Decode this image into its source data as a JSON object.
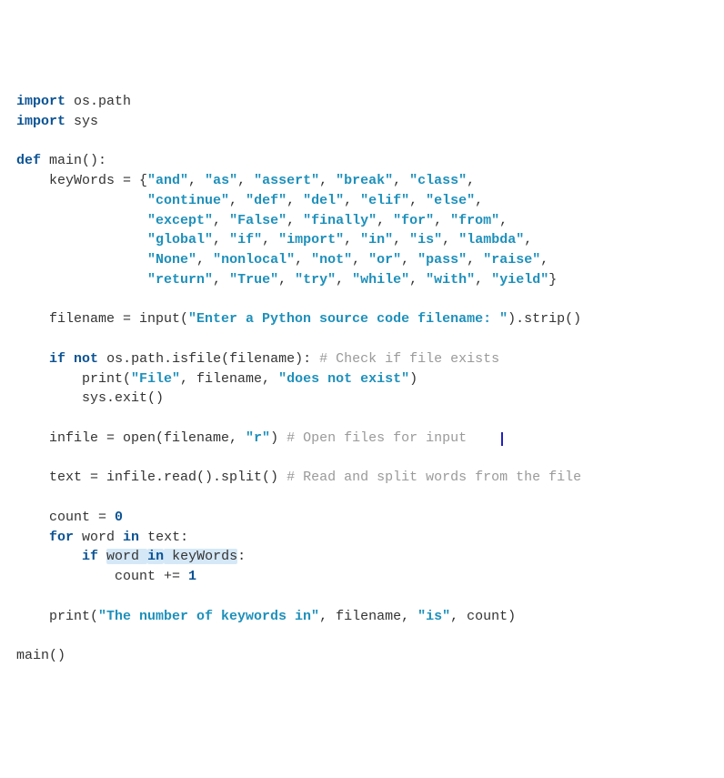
{
  "tokens": [
    {
      "t": "import",
      "c": "kw"
    },
    {
      "t": " os.path\n"
    },
    {
      "t": "import",
      "c": "kw"
    },
    {
      "t": " sys\n\n"
    },
    {
      "t": "def",
      "c": "kw"
    },
    {
      "t": " main():\n"
    },
    {
      "t": "    keyWords = {"
    },
    {
      "t": "\"and\"",
      "c": "str"
    },
    {
      "t": ", "
    },
    {
      "t": "\"as\"",
      "c": "str"
    },
    {
      "t": ", "
    },
    {
      "t": "\"assert\"",
      "c": "str"
    },
    {
      "t": ", "
    },
    {
      "t": "\"break\"",
      "c": "str"
    },
    {
      "t": ", "
    },
    {
      "t": "\"class\"",
      "c": "str"
    },
    {
      "t": ",\n"
    },
    {
      "t": "                "
    },
    {
      "t": "\"continue\"",
      "c": "str"
    },
    {
      "t": ", "
    },
    {
      "t": "\"def\"",
      "c": "str"
    },
    {
      "t": ", "
    },
    {
      "t": "\"del\"",
      "c": "str"
    },
    {
      "t": ", "
    },
    {
      "t": "\"elif\"",
      "c": "str"
    },
    {
      "t": ", "
    },
    {
      "t": "\"else\"",
      "c": "str"
    },
    {
      "t": ",\n"
    },
    {
      "t": "                "
    },
    {
      "t": "\"except\"",
      "c": "str"
    },
    {
      "t": ", "
    },
    {
      "t": "\"False\"",
      "c": "str"
    },
    {
      "t": ", "
    },
    {
      "t": "\"finally\"",
      "c": "str"
    },
    {
      "t": ", "
    },
    {
      "t": "\"for\"",
      "c": "str"
    },
    {
      "t": ", "
    },
    {
      "t": "\"from\"",
      "c": "str"
    },
    {
      "t": ",\n"
    },
    {
      "t": "                "
    },
    {
      "t": "\"global\"",
      "c": "str"
    },
    {
      "t": ", "
    },
    {
      "t": "\"if\"",
      "c": "str"
    },
    {
      "t": ", "
    },
    {
      "t": "\"import\"",
      "c": "str"
    },
    {
      "t": ", "
    },
    {
      "t": "\"in\"",
      "c": "str"
    },
    {
      "t": ", "
    },
    {
      "t": "\"is\"",
      "c": "str"
    },
    {
      "t": ", "
    },
    {
      "t": "\"lambda\"",
      "c": "str"
    },
    {
      "t": ",\n"
    },
    {
      "t": "                "
    },
    {
      "t": "\"None\"",
      "c": "str"
    },
    {
      "t": ", "
    },
    {
      "t": "\"nonlocal\"",
      "c": "str"
    },
    {
      "t": ", "
    },
    {
      "t": "\"not\"",
      "c": "str"
    },
    {
      "t": ", "
    },
    {
      "t": "\"or\"",
      "c": "str"
    },
    {
      "t": ", "
    },
    {
      "t": "\"pass\"",
      "c": "str"
    },
    {
      "t": ", "
    },
    {
      "t": "\"raise\"",
      "c": "str"
    },
    {
      "t": ",\n"
    },
    {
      "t": "                "
    },
    {
      "t": "\"return\"",
      "c": "str"
    },
    {
      "t": ", "
    },
    {
      "t": "\"True\"",
      "c": "str"
    },
    {
      "t": ", "
    },
    {
      "t": "\"try\"",
      "c": "str"
    },
    {
      "t": ", "
    },
    {
      "t": "\"while\"",
      "c": "str"
    },
    {
      "t": ", "
    },
    {
      "t": "\"with\"",
      "c": "str"
    },
    {
      "t": ", "
    },
    {
      "t": "\"yield\"",
      "c": "str"
    },
    {
      "t": "}\n\n"
    },
    {
      "t": "    filename = input("
    },
    {
      "t": "\"Enter a Python source code filename: \"",
      "c": "str"
    },
    {
      "t": ").strip()\n\n"
    },
    {
      "t": "    "
    },
    {
      "t": "if",
      "c": "kw"
    },
    {
      "t": " "
    },
    {
      "t": "not",
      "c": "kw"
    },
    {
      "t": " os.path.isfile(filename): "
    },
    {
      "t": "# Check if file exists",
      "c": "cmt"
    },
    {
      "t": "\n"
    },
    {
      "t": "        print("
    },
    {
      "t": "\"File\"",
      "c": "str"
    },
    {
      "t": ", filename, "
    },
    {
      "t": "\"does not exist\"",
      "c": "str"
    },
    {
      "t": ")\n"
    },
    {
      "t": "        sys.exit()\n\n"
    },
    {
      "t": "    infile = open(filename, "
    },
    {
      "t": "\"r\"",
      "c": "str"
    },
    {
      "t": ") "
    },
    {
      "t": "# Open files for input",
      "c": "cmt"
    },
    {
      "t": "    "
    },
    {
      "t": "",
      "c": "cursor"
    },
    {
      "t": "\n\n"
    },
    {
      "t": "    text = infile.read().split() "
    },
    {
      "t": "# Read and split words from the file",
      "c": "cmt"
    },
    {
      "t": "\n\n"
    },
    {
      "t": "    count = "
    },
    {
      "t": "0",
      "c": "num"
    },
    {
      "t": "\n"
    },
    {
      "t": "    "
    },
    {
      "t": "for",
      "c": "kw"
    },
    {
      "t": " word "
    },
    {
      "t": "in",
      "c": "kw"
    },
    {
      "t": " text:\n"
    },
    {
      "t": "        "
    },
    {
      "t": "if",
      "c": "kw"
    },
    {
      "t": " "
    },
    {
      "t": "word ",
      "c": "hl"
    },
    {
      "t": "in",
      "c": "kw hl"
    },
    {
      "t": " keyWords",
      "c": "hl"
    },
    {
      "t": ":\n"
    },
    {
      "t": "            count += "
    },
    {
      "t": "1",
      "c": "num"
    },
    {
      "t": "\n\n"
    },
    {
      "t": "    print("
    },
    {
      "t": "\"The number of keywords in\"",
      "c": "str"
    },
    {
      "t": ", filename, "
    },
    {
      "t": "\"is\"",
      "c": "str"
    },
    {
      "t": ", count)\n\n"
    },
    {
      "t": "main()"
    }
  ]
}
